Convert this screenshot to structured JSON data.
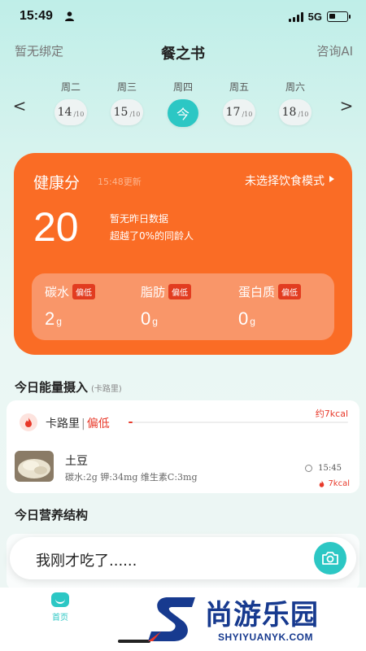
{
  "status_bar": {
    "time": "15:49",
    "network": "5G"
  },
  "header": {
    "left": "暂无绑定",
    "title": "餐之书",
    "right": "咨询AI"
  },
  "week": {
    "prev": "<",
    "next": ">",
    "days": [
      {
        "name": "周二",
        "date": "14",
        "month": "/10"
      },
      {
        "name": "周三",
        "date": "15",
        "month": "/10"
      },
      {
        "name": "周四",
        "date": "今",
        "month": ""
      },
      {
        "name": "周五",
        "date": "17",
        "month": "/10"
      },
      {
        "name": "周六",
        "date": "18",
        "month": "/10"
      }
    ],
    "selected_index": 2
  },
  "health": {
    "title": "健康分",
    "updated": "15:48更新",
    "mode": "未选择饮食模式",
    "score": "20",
    "note1": "暂无昨日数据",
    "note2": "超越了0%的同龄人",
    "macros": [
      {
        "name": "碳水",
        "badge": "偏低",
        "value": "2",
        "unit": "g"
      },
      {
        "name": "脂肪",
        "badge": "偏低",
        "value": "0",
        "unit": "g"
      },
      {
        "name": "蛋白质",
        "badge": "偏低",
        "value": "0",
        "unit": "g"
      }
    ]
  },
  "energy": {
    "title": "今日能量摄入",
    "subtitle": "(卡路里)",
    "label": "卡路里",
    "separator": "|",
    "status": "偏低",
    "approx": "约7kcal",
    "progress": 0.02
  },
  "food_item": {
    "name": "土豆",
    "nutrients": "碳水:2g 钾:34mg 维生素C:3mg",
    "time": "15:45",
    "kcal": "7kcal"
  },
  "nutrition": {
    "title": "今日营养结构"
  },
  "input": {
    "placeholder": "我刚才吃了......"
  },
  "tabs": {
    "home": "首页"
  },
  "watermark": {
    "text": "尚游乐园",
    "sub": "SHYIYUANYK.COM"
  },
  "colors": {
    "accent": "#2cc7c4",
    "card": "#fa6c25",
    "alert": "#e8392a",
    "watermark": "#173a8f"
  }
}
